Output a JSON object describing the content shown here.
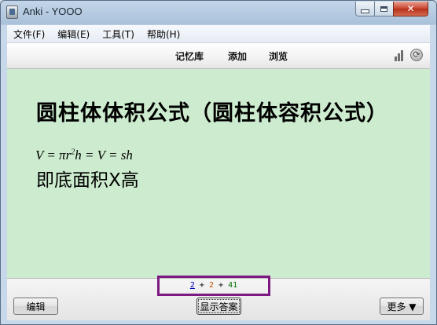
{
  "window": {
    "title": "Anki - YOOO",
    "close_glyph": "✕"
  },
  "menu": {
    "items": [
      "文件(F)",
      "编辑(E)",
      "工具(T)",
      "帮助(H)"
    ]
  },
  "toolbar": {
    "decks_label": "记忆库",
    "add_label": "添加",
    "browse_label": "浏览",
    "sync_glyph": "⟳"
  },
  "card": {
    "title": "圆柱体体积公式（圆柱体容积公式）",
    "formula_prefix": "V = πr",
    "formula_exponent": "2",
    "formula_suffix": "h = V = sh",
    "text": "即底面积X高"
  },
  "bottom": {
    "counts": {
      "new": "2",
      "learn": "2",
      "review": "41",
      "separator": "+"
    },
    "edit_label": "编辑",
    "show_answer_label": "显示答案",
    "more_label": "更多 ▼"
  },
  "colors": {
    "card_background": "#cdeccf",
    "highlight_border": "#7d1a82",
    "new_count": "#0000c0",
    "learn_count": "#c05000",
    "review_count": "#007000"
  }
}
